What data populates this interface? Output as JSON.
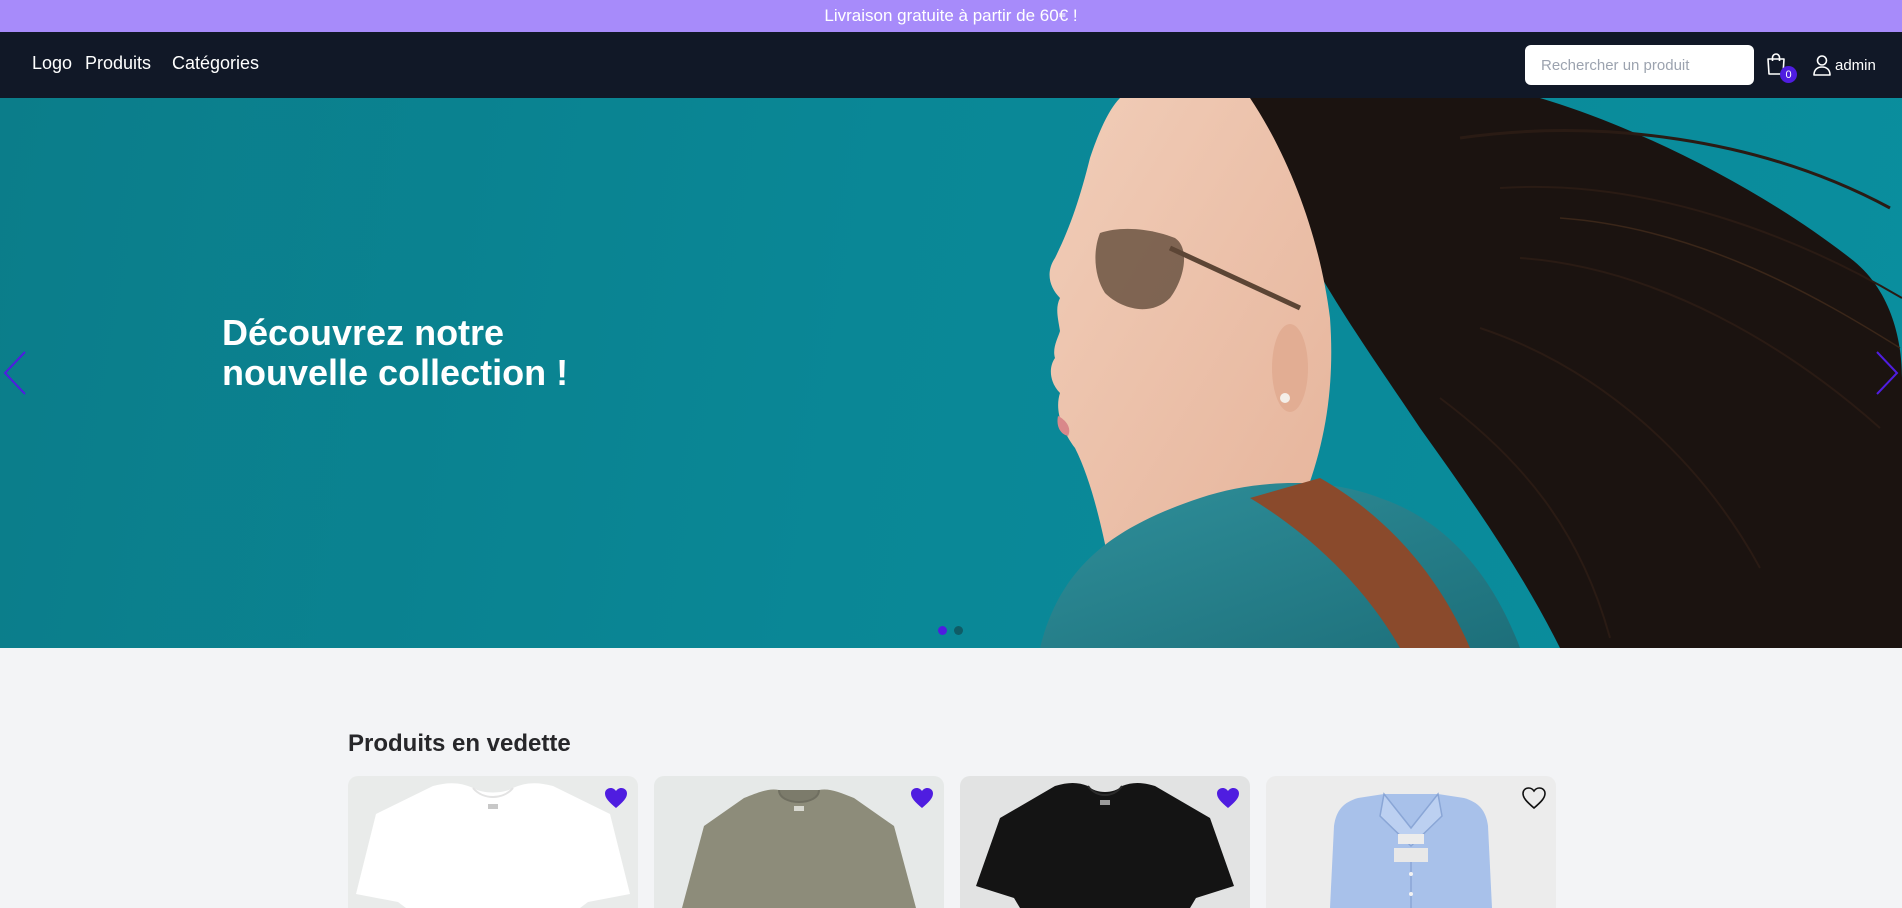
{
  "promo": {
    "text": "Livraison gratuite à partir de 60€ !"
  },
  "nav": {
    "logo": "Logo",
    "links": [
      "Produits",
      "Catégories"
    ],
    "search_placeholder": "Rechercher un produit",
    "cart_count": "0",
    "user_label": "admin"
  },
  "hero": {
    "title": "Découvrez notre nouvelle collection !",
    "slide_count": 2,
    "active_slide": 1
  },
  "featured": {
    "title": "Produits en vedette",
    "products": [
      {
        "image": "white-tshirt",
        "favorited": true
      },
      {
        "image": "olive-tshirt",
        "favorited": true
      },
      {
        "image": "black-tshirt",
        "favorited": true
      },
      {
        "image": "blue-shirt",
        "favorited": false
      }
    ]
  },
  "colors": {
    "promo_bg": "#a78bfa",
    "nav_bg": "#111827",
    "accent": "#4f1de0",
    "hero_bg": "#0a8796",
    "page_bg": "#f3f4f6"
  }
}
